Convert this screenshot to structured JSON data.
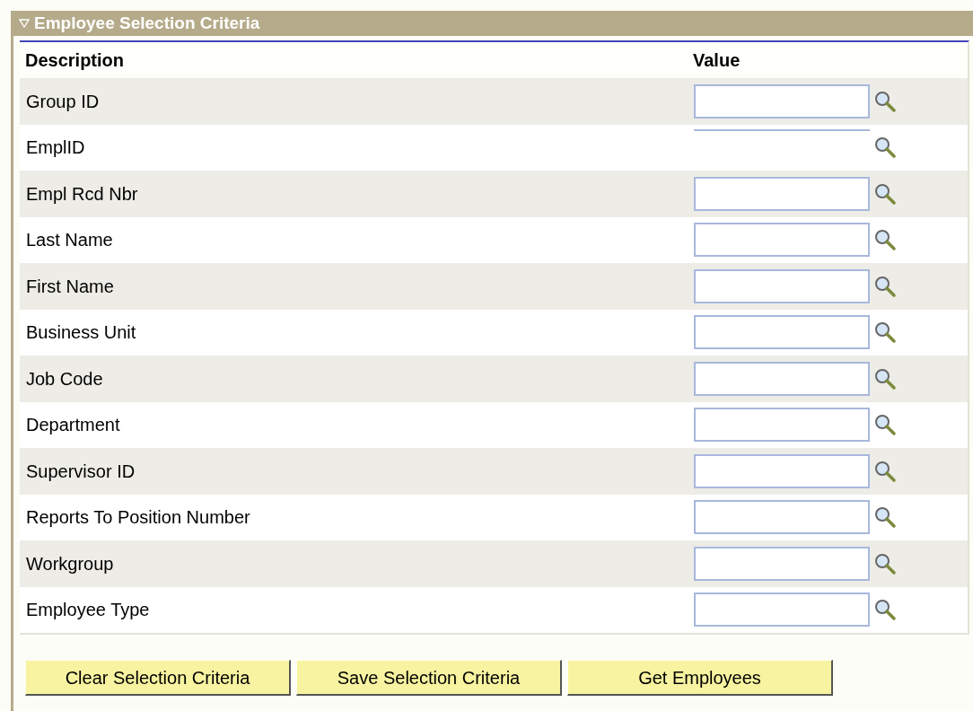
{
  "section": {
    "title": "Employee Selection Criteria",
    "expanded": true
  },
  "table": {
    "columns": [
      "Description",
      "Value"
    ],
    "rows": [
      {
        "label": "Group ID",
        "kind": "field"
      },
      {
        "label": "EmplID",
        "kind": "line"
      },
      {
        "label": "Empl Rcd Nbr",
        "kind": "field"
      },
      {
        "label": "Last Name",
        "kind": "field"
      },
      {
        "label": "First Name",
        "kind": "field"
      },
      {
        "label": "Business Unit",
        "kind": "field"
      },
      {
        "label": "Job Code",
        "kind": "field"
      },
      {
        "label": "Department",
        "kind": "field"
      },
      {
        "label": "Supervisor ID",
        "kind": "field"
      },
      {
        "label": "Reports To Position Number",
        "kind": "field"
      },
      {
        "label": "Workgroup",
        "kind": "field"
      },
      {
        "label": "Employee Type",
        "kind": "field"
      }
    ]
  },
  "buttons": [
    "Clear Selection Criteria",
    "Save Selection Criteria",
    "Get Employees"
  ]
}
